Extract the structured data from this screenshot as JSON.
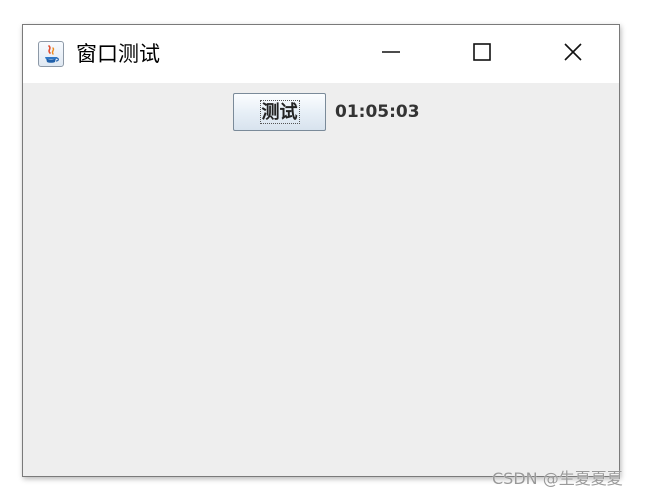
{
  "window": {
    "title": "窗口测试",
    "app_icon": "java-coffee-icon",
    "controls": {
      "minimize_icon": "minimize-icon",
      "maximize_icon": "maximize-icon",
      "close_icon": "close-icon"
    }
  },
  "content": {
    "button_label": "测试",
    "time_text": "01:05:03"
  },
  "watermark": "CSDN @生夏夏夏",
  "colors": {
    "window_background": "#eeeeee",
    "titlebar_background": "#ffffff",
    "button_border": "#7a8a99"
  }
}
